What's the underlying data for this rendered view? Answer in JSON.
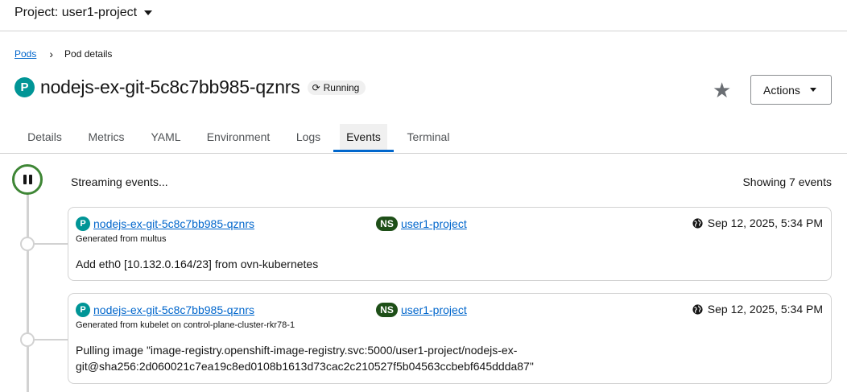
{
  "project_bar": {
    "label": "Project: user1-project"
  },
  "breadcrumb": {
    "items": [
      "Pods",
      "Pod details"
    ]
  },
  "header": {
    "resource_badge": "P",
    "title": "nodejs-ex-git-5c8c7bb985-qznrs",
    "status": "Running",
    "status_icon": "sync-icon",
    "favorite_icon": "star-icon",
    "actions_label": "Actions"
  },
  "tabs": [
    {
      "label": "Details"
    },
    {
      "label": "Metrics"
    },
    {
      "label": "YAML"
    },
    {
      "label": "Environment"
    },
    {
      "label": "Logs"
    },
    {
      "label": "Events",
      "active": true
    },
    {
      "label": "Terminal"
    }
  ],
  "events_panel": {
    "streaming_text": "Streaming events...",
    "showing_text": "Showing 7 events",
    "pause_icon": "pause-icon"
  },
  "events": [
    {
      "pod_badge": "P",
      "pod_name": "nodejs-ex-git-5c8c7bb985-qznrs",
      "ns_badge": "NS",
      "namespace": "user1-project",
      "timestamp": "Sep 12, 2025, 5:34 PM",
      "source": "Generated from multus",
      "message": "Add eth0 [10.132.0.164/23] from ovn-kubernetes"
    },
    {
      "pod_badge": "P",
      "pod_name": "nodejs-ex-git-5c8c7bb985-qznrs",
      "ns_badge": "NS",
      "namespace": "user1-project",
      "timestamp": "Sep 12, 2025, 5:34 PM",
      "source": "Generated from kubelet on control-plane-cluster-rkr78-1",
      "message_line1": "Pulling image \"image-registry.openshift-image-registry.svc:5000/user1-project/nodejs-ex-",
      "message_line2": "git@sha256:2d060021c7ea19c8ed0108b1613d73cac2c210527f5b04563ccbebf645ddda87\""
    }
  ],
  "colors": {
    "link": "#0066cc",
    "pod_badge": "#009596",
    "ns_badge": "#1e4f18",
    "active_tab": "#0066cc",
    "pause_ring": "#3e8635"
  }
}
